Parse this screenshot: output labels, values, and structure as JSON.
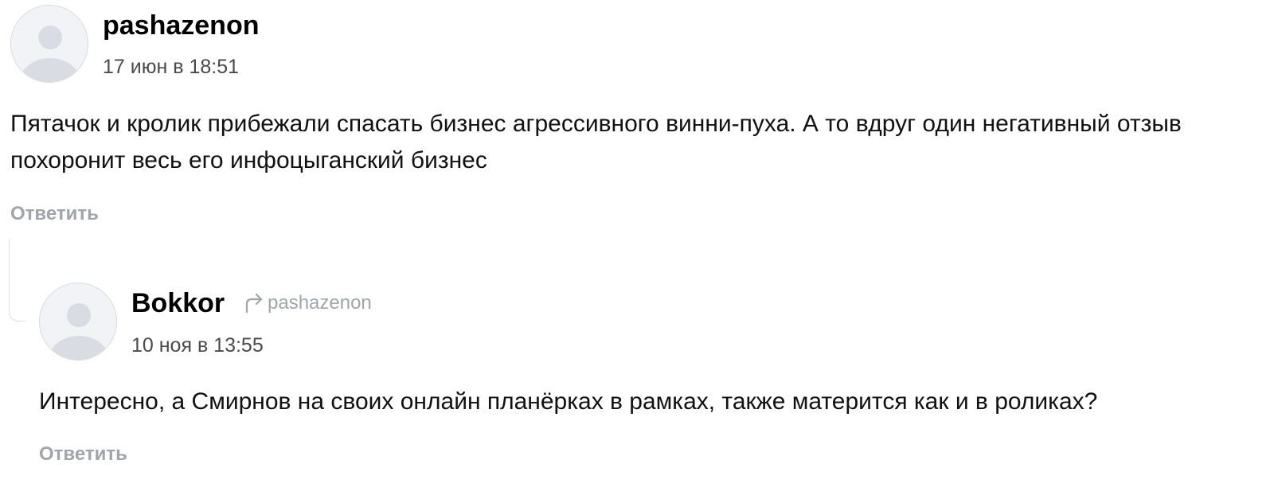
{
  "comments": [
    {
      "author": "pashazenon",
      "date": "17 июн в 18:51",
      "text": "Пятачок и кролик прибежали спасать бизнес агрессивного винни-пуха. А то вдруг один негативный отзыв похоронит весь его инфоцыганский бизнес",
      "reply_label": "Ответить"
    },
    {
      "author": "Bokkor",
      "reply_to": "pashazenon",
      "date": "10 ноя в 13:55",
      "text": "Интересно, а Смирнов на своих онлайн планёрках в рамках, также матерится как и в роликах?",
      "reply_label": "Ответить"
    }
  ],
  "icons": {
    "avatar": "user-placeholder-icon",
    "reply_to": "reply-arrow-icon"
  },
  "colors": {
    "muted": "#a0a4ad",
    "avatar_bg": "#f2f3f6",
    "avatar_figure": "#d9dce3"
  }
}
